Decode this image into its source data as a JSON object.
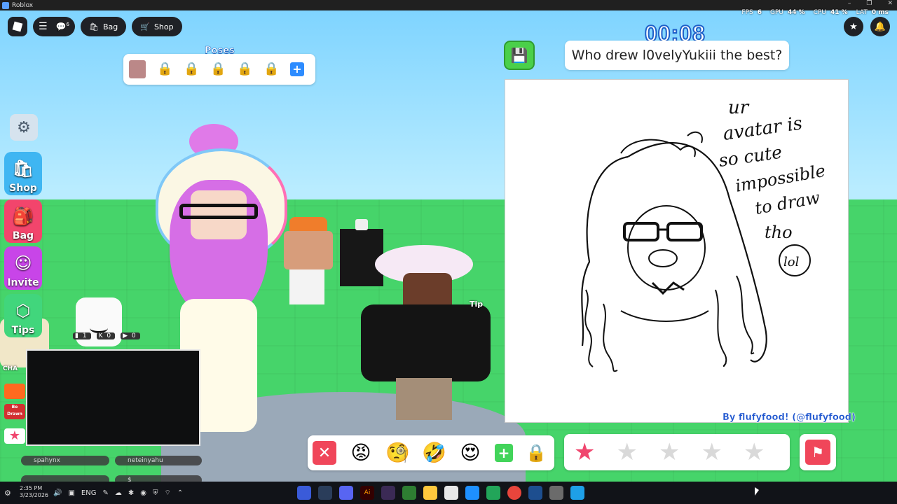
{
  "window": {
    "title": "Roblox",
    "controls": [
      "–",
      "❐",
      "✕"
    ]
  },
  "performance": {
    "fps_label": "FPS",
    "fps_value": "6",
    "gpu_label": "GPU",
    "gpu_value": "44 %",
    "cpu_label": "CPU",
    "cpu_value": "41 %",
    "lat_label": "LAT",
    "lat_value": "0 ms"
  },
  "topbar": {
    "menu_badge": "6",
    "bag_label": "Bag",
    "shop_label": "Shop"
  },
  "poses": {
    "title": "Poses",
    "locked_count": 5
  },
  "timer": "00:08",
  "prompt": "Who drew l0velyYukiii the best?",
  "drawing": {
    "lines": [
      "ur",
      "avatar is",
      "so cute",
      "impossible",
      "to draw",
      "tho"
    ],
    "lol": "lol",
    "byline": "By flufyfood! (@flufyfood)"
  },
  "sidebar": {
    "shop": "Shop",
    "bag": "Bag",
    "invite": "Invite",
    "tips": "Tips",
    "chat_label": "CHA",
    "be_drawn": "Be Drawn"
  },
  "counters": {
    "twitch": "1",
    "kick": "0",
    "youtube": "0"
  },
  "scene": {
    "tip_label": "Tip"
  },
  "users": {
    "user1": "spahynx",
    "user2": "neteinyahu",
    "user3": "$"
  },
  "reactions": {
    "close": "✕",
    "emojis": [
      "😡",
      "🧐",
      "🤣",
      "😍"
    ],
    "add": "+"
  },
  "rating": {
    "stars_total": 5,
    "stars_selected": 1
  },
  "taskbar": {
    "time": "2:35 PM",
    "date": "3/23/2026",
    "lang": "ENG"
  },
  "colors": {
    "sky": "#7fd4ff",
    "ground": "#46d46a",
    "accent_blue": "#1d5fc8",
    "accent_red": "#f0465a",
    "save_green": "#4ad04a"
  }
}
